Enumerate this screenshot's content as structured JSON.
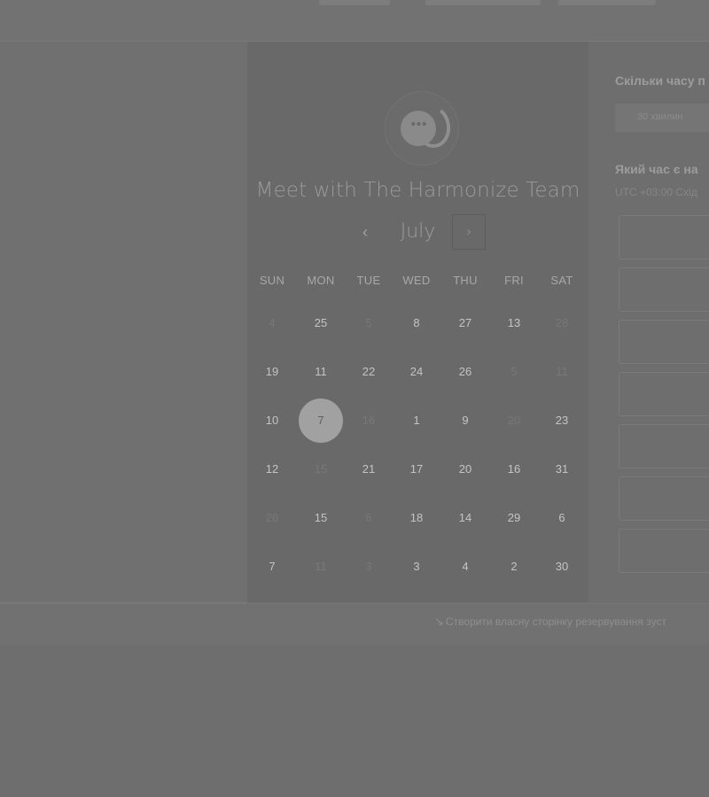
{
  "booking": {
    "title": "Meet with The Harmonize Team",
    "month": "July",
    "prev_label": "‹",
    "next_label": "›",
    "weekdays": [
      "SUN",
      "MON",
      "TUE",
      "WED",
      "THU",
      "FRI",
      "SAT"
    ],
    "weeks": [
      [
        {
          "d": "4",
          "muted": true
        },
        {
          "d": "25"
        },
        {
          "d": "5",
          "muted": true
        },
        {
          "d": "8"
        },
        {
          "d": "27"
        },
        {
          "d": "13"
        },
        {
          "d": "28",
          "muted": true
        }
      ],
      [
        {
          "d": "19"
        },
        {
          "d": "11"
        },
        {
          "d": "22"
        },
        {
          "d": "24"
        },
        {
          "d": "26"
        },
        {
          "d": "5",
          "muted": true
        },
        {
          "d": "11",
          "muted": true
        }
      ],
      [
        {
          "d": "10"
        },
        {
          "d": "7",
          "selected": true
        },
        {
          "d": "16",
          "muted": true
        },
        {
          "d": "1"
        },
        {
          "d": "9"
        },
        {
          "d": "20",
          "muted": true
        },
        {
          "d": "23"
        }
      ],
      [
        {
          "d": "12"
        },
        {
          "d": "15",
          "muted": true
        },
        {
          "d": "21"
        },
        {
          "d": "17"
        },
        {
          "d": "20"
        },
        {
          "d": "16"
        },
        {
          "d": "31"
        }
      ],
      [
        {
          "d": "26",
          "muted": true
        },
        {
          "d": "15"
        },
        {
          "d": "6",
          "muted": true
        },
        {
          "d": "18"
        },
        {
          "d": "14"
        },
        {
          "d": "29"
        },
        {
          "d": "6"
        }
      ],
      [
        {
          "d": "7"
        },
        {
          "d": "11",
          "muted": true
        },
        {
          "d": "3",
          "muted": true
        },
        {
          "d": "3"
        },
        {
          "d": "4"
        },
        {
          "d": "2"
        },
        {
          "d": "30"
        }
      ]
    ]
  },
  "right_panel": {
    "duration_heading": "Скільки часу п",
    "duration_option": "30 хвилин",
    "time_heading": "Який час є на",
    "timezone": "UTC +03:00 Схід",
    "slot_count": 7
  },
  "footer": {
    "link_icon": "hubspot-sprocket-icon",
    "link_text": "Створити власну сторінку резервування зуст"
  },
  "colors": {
    "overlay_bg": "#6e6e6e",
    "card_bg": "#696969",
    "selected_day": "#a1a1a1"
  }
}
